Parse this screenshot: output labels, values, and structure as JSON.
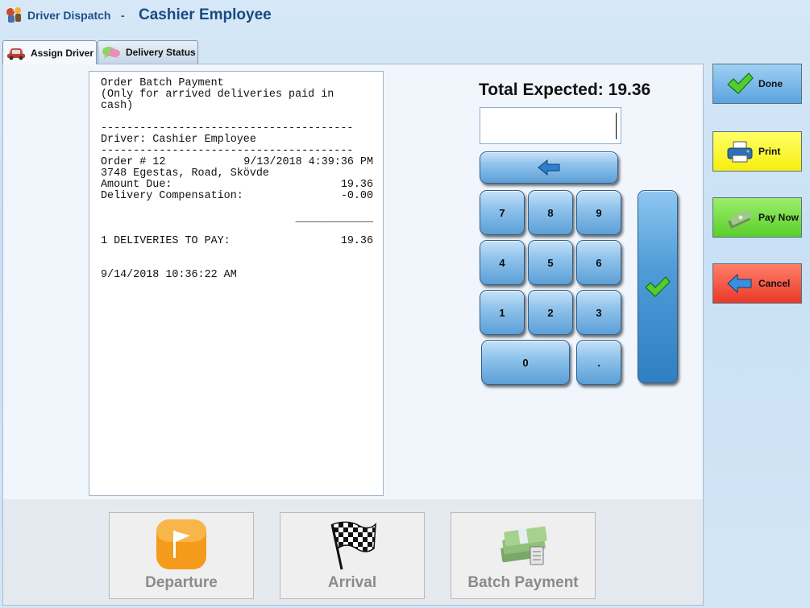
{
  "app": {
    "name": "Driver Dispatch",
    "separator": "-",
    "title": "Cashier Employee",
    "icon": "app-logo-icon"
  },
  "tabs": [
    {
      "label": "Assign Driver",
      "icon": "car-icon",
      "active": true
    },
    {
      "label": "Delivery Status",
      "icon": "speech-bubbles-icon",
      "active": false
    }
  ],
  "receipt": {
    "lines": [
      "Order Batch Payment",
      "(Only for arrived deliveries paid in",
      "cash)",
      "",
      "---------------------------------------",
      "Driver: Cashier Employee",
      "---------------------------------------"
    ],
    "order_label": "Order # 12",
    "order_datetime": "9/13/2018 4:39:36 PM",
    "address": "3748 Egestas, Road, Skövde",
    "amount_due_label": "Amount Due:",
    "amount_due_value": "19.36",
    "compensation_label": "Delivery Compensation:",
    "compensation_value": "-0.00",
    "underline": "____________",
    "deliveries_label": "1 DELIVERIES TO PAY:",
    "deliveries_value": "19.36",
    "printed_at": "9/14/2018 10:36:22 AM"
  },
  "payment": {
    "total_expected": "Total Expected: 19.36",
    "input_value": ""
  },
  "keypad": {
    "backspace_icon": "back-arrow-icon",
    "keys": [
      "7",
      "8",
      "9",
      "4",
      "5",
      "6",
      "1",
      "2",
      "3",
      "0",
      "."
    ],
    "enter_icon": "checkmark-icon"
  },
  "side_buttons": {
    "done": "Done",
    "print": "Print",
    "pay_now": "Pay Now",
    "cancel": "Cancel"
  },
  "bottom_buttons": {
    "departure": "Departure",
    "arrival": "Arrival",
    "batch_payment": "Batch Payment"
  },
  "colors": {
    "title_blue": "#1a4a80",
    "done": "#5aa4df",
    "print": "#f6ee10",
    "pay_now": "#59cf2b",
    "cancel": "#e83a27",
    "keypad": "#5c9fd6"
  }
}
